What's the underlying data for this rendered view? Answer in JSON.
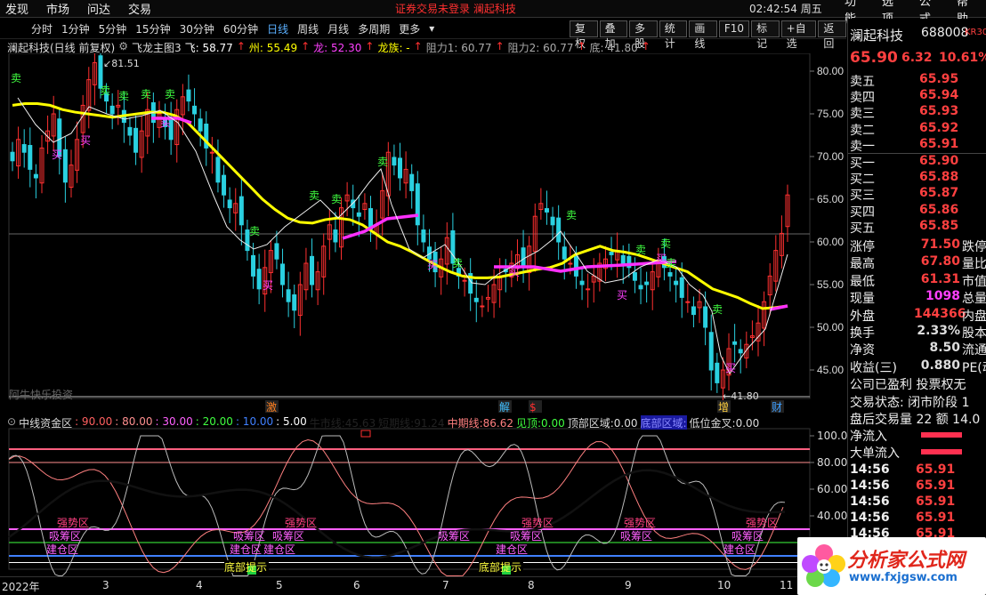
{
  "topbar": {
    "menu": [
      "发现",
      "市场",
      "问达",
      "交易"
    ],
    "notice": "证券交易未登录  澜起科技",
    "clock": "02:42:54 周五",
    "right_menu": [
      "功能",
      "选项",
      "公式",
      "帮助"
    ]
  },
  "toolbar": {
    "periods": [
      "分时",
      "1分钟",
      "5分钟",
      "15分钟",
      "30分钟",
      "60分钟",
      "日线",
      "周线",
      "月线",
      "多周期",
      "更多"
    ],
    "active": "日线",
    "buttons": [
      "复权",
      "叠加",
      "多股",
      "统计",
      "画线",
      "F10",
      "标记",
      "+自选",
      "返回"
    ]
  },
  "main_legend": {
    "title": "澜起科技(日线 前复权)",
    "indicator": "飞龙主图3",
    "items": [
      {
        "label": "飞:",
        "value": "58.77",
        "color": "#ffffff"
      },
      {
        "label": "州:",
        "value": "55.49",
        "color": "#ffff00"
      },
      {
        "label": "龙:",
        "value": "52.30",
        "color": "#ff40ff"
      },
      {
        "label": "龙族:",
        "value": "-",
        "color": "#ffff00"
      },
      {
        "label": "阻力1:",
        "value": "60.77",
        "color": "#888888"
      },
      {
        "label": "阻力2:",
        "value": "60.77",
        "color": "#888888"
      },
      {
        "label": "底:",
        "value": "41.80",
        "color": "#888888"
      }
    ]
  },
  "main_axis": {
    "ticks": [
      "80.00",
      "75.00",
      "70.00",
      "65.00",
      "60.00",
      "55.00",
      "50.00",
      "45.00"
    ],
    "high_label": "81.51",
    "low_label": "41.80",
    "watermark": "阿牛快乐投资"
  },
  "signals": {
    "buy": "买",
    "sell": "卖",
    "events": [
      "激",
      "解",
      "$",
      "增",
      "财"
    ]
  },
  "sub_legend": {
    "title": "中线资金区",
    "items": [
      {
        "label": "",
        "value": "90.00",
        "color": "#ff6060"
      },
      {
        "label": "",
        "value": "80.00",
        "color": "#ff9090"
      },
      {
        "label": "",
        "value": "30.00",
        "color": "#ff60ff"
      },
      {
        "label": "",
        "value": "20.00",
        "color": "#40ff40"
      },
      {
        "label": "",
        "value": "10.00",
        "color": "#4080ff"
      },
      {
        "label": "",
        "value": "5.00",
        "color": "#ffffff"
      },
      {
        "label": "牛市线:",
        "value": "45.63",
        "color": "#000000"
      },
      {
        "label": "短期线:",
        "value": "91.24",
        "color": "#000000"
      },
      {
        "label": "中期线:",
        "value": "86.62",
        "color": "#ff8080"
      },
      {
        "label": "见顶:",
        "value": "0.00",
        "color": "#40ff40"
      },
      {
        "label": "顶部区域:",
        "value": "0.00",
        "color": "#dddddd"
      },
      {
        "label": "底部区域:",
        "value": "",
        "color": "#3030ff"
      },
      {
        "label": "低位金叉:",
        "value": "0.00",
        "color": "#dddddd"
      }
    ]
  },
  "sub_axis": {
    "ticks": [
      "100.0",
      "80.00",
      "60.00",
      "40.00",
      "20.00"
    ]
  },
  "sub_labels": {
    "strong": "强势区",
    "absorb": "吸筹区",
    "build": "建仓区",
    "bottom": "底部提示"
  },
  "x_labels": [
    "2022年",
    "3",
    "4",
    "5",
    "6",
    "7",
    "8",
    "9",
    "10",
    "11"
  ],
  "quote": {
    "name": "澜起科技",
    "code": "688008",
    "tag": "KR30",
    "price": "65.90",
    "change": "6.32",
    "pct": "10.61%",
    "asks": [
      {
        "label": "卖五",
        "value": "65.95"
      },
      {
        "label": "卖四",
        "value": "65.94"
      },
      {
        "label": "卖三",
        "value": "65.93"
      },
      {
        "label": "卖二",
        "value": "65.92"
      },
      {
        "label": "卖一",
        "value": "65.91"
      }
    ],
    "bids": [
      {
        "label": "买一",
        "value": "65.90"
      },
      {
        "label": "买二",
        "value": "65.88"
      },
      {
        "label": "买三",
        "value": "65.87"
      },
      {
        "label": "买四",
        "value": "65.86"
      },
      {
        "label": "买五",
        "value": "65.85"
      }
    ],
    "stats": [
      {
        "label": "涨停",
        "value": "71.50",
        "color": "#ff4040",
        "tail": "跌停"
      },
      {
        "label": "最高",
        "value": "67.80",
        "color": "#ff4040",
        "tail": "量比"
      },
      {
        "label": "最低",
        "value": "61.31",
        "color": "#ff4040",
        "tail": "市值"
      },
      {
        "label": "现量",
        "value": "1098",
        "color": "#ff40ff",
        "tail": "总量"
      },
      {
        "label": "外盘",
        "value": "144366",
        "color": "#ff4040",
        "tail": "内盘"
      },
      {
        "label": "换手",
        "value": "2.33%",
        "color": "#dddddd",
        "tail": "股本"
      },
      {
        "label": "净资",
        "value": "8.50",
        "color": "#dddddd",
        "tail": "流通"
      },
      {
        "label": "收益(三)",
        "value": "0.880",
        "color": "#dddddd",
        "tail": "PE(动"
      }
    ],
    "info": [
      "公司已盈利 投票权无",
      "交易状态: 闭市阶段 1",
      "盘后交易量 22 额 14.0"
    ],
    "flows": [
      {
        "label": "净流入"
      },
      {
        "label": "大单流入"
      }
    ],
    "ticks": [
      {
        "time": "14:56",
        "price": "65.91"
      },
      {
        "time": "14:56",
        "price": "65.91"
      },
      {
        "time": "14:56",
        "price": "65.91"
      },
      {
        "time": "14:56",
        "price": "65.91"
      },
      {
        "time": "14:56",
        "price": "65.91"
      }
    ]
  },
  "watermark": {
    "text": "分析家公式网",
    "url": "www.fxjgsw.com"
  },
  "chart_data": {
    "type": "candlestick",
    "ylim": [
      41,
      83
    ],
    "closes": [
      69.5,
      72.0,
      70.5,
      68.5,
      67.5,
      71.0,
      73.0,
      75.0,
      70.0,
      67.0,
      69.0,
      72.0,
      76.0,
      79.0,
      81.0,
      78.0,
      76.5,
      75.0,
      76.0,
      74.0,
      72.5,
      70.5,
      73.0,
      75.5,
      74.0,
      75.0,
      73.5,
      72.0,
      75.5,
      77.0,
      76.5,
      75.0,
      73.0,
      71.0,
      70.5,
      67.0,
      65.5,
      64.0,
      64.5,
      62.0,
      59.0,
      56.0,
      54.5,
      57.0,
      59.0,
      58.0,
      55.0,
      53.0,
      52.0,
      55.0,
      57.5,
      55.0,
      56.5,
      59.5,
      62.0,
      60.0,
      64.0,
      65.5,
      64.0,
      63.0,
      64.5,
      61.5,
      62.0,
      66.0,
      70.5,
      69.0,
      67.5,
      68.5,
      66.0,
      62.0,
      60.0,
      58.0,
      56.5,
      58.0,
      60.5,
      57.5,
      56.0,
      55.5,
      54.0,
      53.0,
      52.5,
      53.5,
      55.0,
      56.0,
      56.5,
      57.5,
      58.5,
      57.0,
      59.5,
      63.0,
      64.5,
      63.5,
      62.0,
      60.0,
      58.0,
      57.5,
      56.0,
      55.0,
      54.5,
      56.0,
      57.5,
      58.0,
      58.5,
      59.0,
      57.5,
      57.0,
      55.5,
      54.5,
      55.0,
      56.5,
      57.5,
      57.0,
      56.0,
      55.0,
      53.5,
      53.0,
      51.5,
      53.0,
      50.0,
      45.0,
      43.5,
      45.0,
      47.5,
      48.0,
      47.0,
      48.0,
      49.0,
      50.5,
      53.0,
      56.0,
      59.0,
      61.0,
      65.5
    ]
  },
  "ma_lines": {
    "yellow": [
      76,
      76.2,
      76.2,
      76,
      75.5,
      75.2,
      75,
      74.8,
      74.6,
      74.8,
      75,
      75.2,
      75.2,
      74.8,
      74,
      72.5,
      71,
      69.5,
      68,
      66.5,
      65,
      63.8,
      62.8,
      62.3,
      62.2,
      62.6,
      62.8,
      62.6,
      62,
      61,
      60,
      59.5,
      58.8,
      58,
      57.2,
      56.5,
      56,
      55.8,
      55.8,
      55.9,
      56.2,
      56.5,
      56.8,
      57,
      57.5,
      58.5,
      59,
      59.5,
      59,
      58.8,
      58.5,
      58,
      57.5,
      57,
      56.5,
      55.5,
      54.5,
      54,
      53.5,
      52.8,
      52.2,
      52.3,
      52.5
    ],
    "magenta_segments": [
      [
        [
          170,
          133
        ],
        [
          200,
          133
        ],
        [
          215,
          138
        ]
      ],
      [
        [
          385,
          268
        ],
        [
          410,
          260
        ],
        [
          435,
          246
        ],
        [
          470,
          242
        ]
      ],
      [
        [
          555,
          300
        ],
        [
          600,
          300
        ],
        [
          630,
          305
        ],
        [
          660,
          300
        ],
        [
          700,
          298
        ],
        [
          730,
          296
        ],
        [
          760,
          294
        ]
      ],
      [
        [
          865,
          348
        ],
        [
          885,
          344
        ]
      ]
    ],
    "white": [
      [
        20,
        110
      ],
      [
        40,
        140
      ],
      [
        60,
        160
      ],
      [
        80,
        150
      ],
      [
        100,
        120
      ],
      [
        120,
        128
      ],
      [
        140,
        134
      ],
      [
        160,
        130
      ],
      [
        180,
        124
      ],
      [
        200,
        138
      ],
      [
        220,
        170
      ],
      [
        240,
        220
      ],
      [
        255,
        255
      ],
      [
        270,
        270
      ],
      [
        285,
        280
      ],
      [
        300,
        275
      ],
      [
        320,
        255
      ],
      [
        340,
        240
      ],
      [
        360,
        225
      ],
      [
        380,
        245
      ],
      [
        400,
        225
      ],
      [
        415,
        205
      ],
      [
        428,
        190
      ],
      [
        440,
        230
      ],
      [
        460,
        280
      ],
      [
        475,
        290
      ],
      [
        500,
        275
      ],
      [
        515,
        295
      ],
      [
        530,
        318
      ],
      [
        545,
        320
      ],
      [
        560,
        308
      ],
      [
        575,
        300
      ],
      [
        590,
        290
      ],
      [
        605,
        282
      ],
      [
        620,
        270
      ],
      [
        630,
        260
      ],
      [
        645,
        282
      ],
      [
        660,
        305
      ],
      [
        680,
        318
      ],
      [
        700,
        314
      ],
      [
        720,
        300
      ],
      [
        740,
        292
      ],
      [
        760,
        300
      ],
      [
        775,
        320
      ],
      [
        790,
        332
      ],
      [
        800,
        350
      ],
      [
        810,
        400
      ],
      [
        820,
        420
      ],
      [
        840,
        392
      ],
      [
        860,
        370
      ],
      [
        875,
        320
      ],
      [
        885,
        286
      ]
    ]
  }
}
